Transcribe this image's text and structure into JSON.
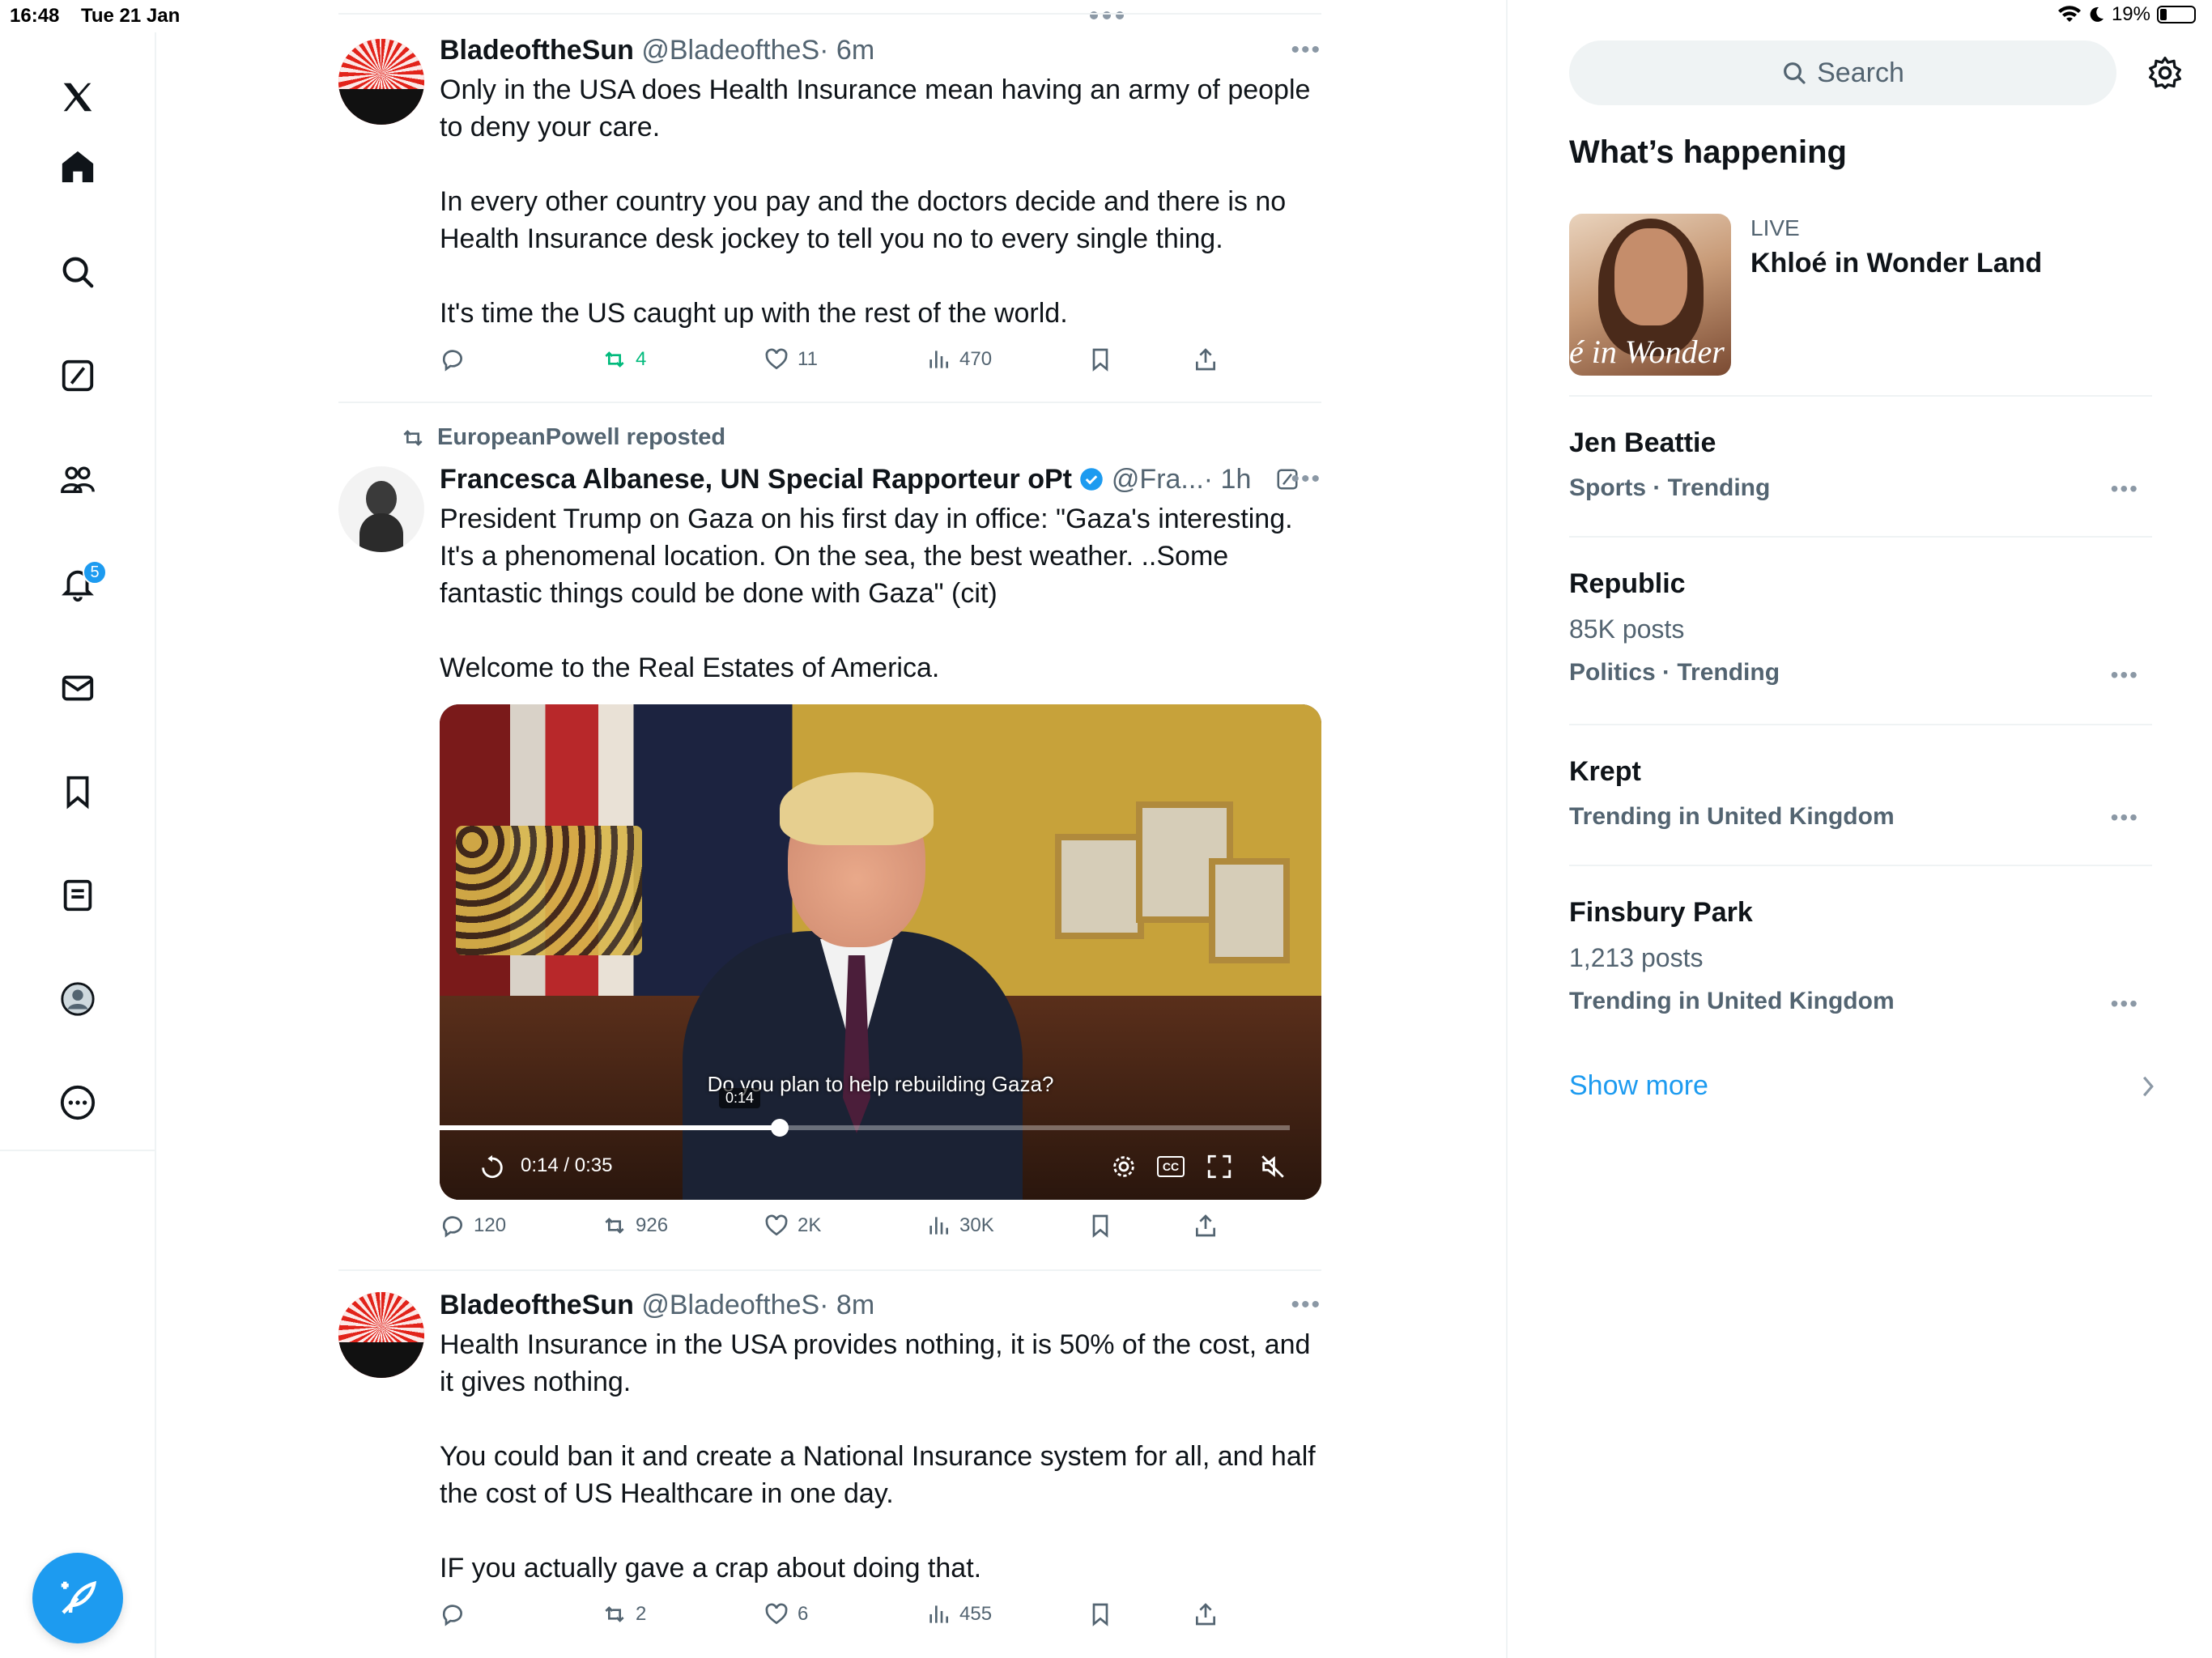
{
  "status": {
    "time": "16:48",
    "date": "Tue 21 Jan",
    "battery": "19%"
  },
  "nav": {
    "items": [
      "home",
      "explore",
      "grok",
      "communities",
      "notifications",
      "messages",
      "bookmarks",
      "lists",
      "profile",
      "more"
    ],
    "notifications_badge": "5"
  },
  "tweets": [
    {
      "name": "BladeoftheSun",
      "handle": "@BladeoftheS",
      "time": "· 6m",
      "text": "Only in the USA does Health Insurance mean having an army of people to deny your care.\n\nIn every other country you pay and the doctors decide and there is no Health Insurance desk jockey to tell you no to every single thing.\n\nIt's time the US caught up with the rest of the world.",
      "reposts": "4",
      "likes": "11",
      "views": "470"
    },
    {
      "reposted_by": "EuropeanPowell reposted",
      "name": "Francesca Albanese, UN Special Rapporteur oPt",
      "handle": "@Fra...",
      "time": "· 1h",
      "text": "President Trump on Gaza on his first day in office: \"Gaza's interesting. It's a phenomenal location. On the sea, the best weather. ..Some fantastic things could be done with Gaza\" (cit)\n\nWelcome to the Real Estates of America.",
      "video": {
        "caption": "Do you plan to help rebuilding Gaza?",
        "scrub_time": "0:14",
        "current": "0:14",
        "separator": "/",
        "duration": "0:35",
        "progress": 0.4,
        "cc_label": "CC"
      },
      "replies": "120",
      "reposts": "926",
      "likes": "2K",
      "views": "30K"
    },
    {
      "name": "BladeoftheSun",
      "handle": "@BladeoftheS",
      "time": "· 8m",
      "text": "Health Insurance in the USA provides nothing, it is 50% of the cost, and it gives nothing.\n\nYou could ban it and create a National Insurance system for all, and half the cost of US Healthcare in one day.\n\nIF you actually gave a crap about doing that.",
      "reposts": "2",
      "likes": "6",
      "views": "455"
    }
  ],
  "sidebar": {
    "search_placeholder": "Search",
    "title": "What’s happening",
    "live": {
      "label": "LIVE",
      "title": "Khloé in Wonder Land",
      "thumb_text": "é in Wonder L"
    },
    "trends": [
      {
        "title": "Jen Beattie",
        "posts": "",
        "meta": "Sports · Trending"
      },
      {
        "title": "Republic",
        "posts": "85K posts",
        "meta": "Politics · Trending"
      },
      {
        "title": "Krept",
        "posts": "",
        "meta": "Trending in United Kingdom"
      },
      {
        "title": "Finsbury Park",
        "posts": "1,213 posts",
        "meta": "Trending in United Kingdom"
      }
    ],
    "show_more": "Show more"
  },
  "colors": {
    "accent": "#1d9bf0",
    "text": "#0f1419",
    "muted": "#536471",
    "repost_active": "#00ba7c",
    "divider": "#eff3f4"
  }
}
